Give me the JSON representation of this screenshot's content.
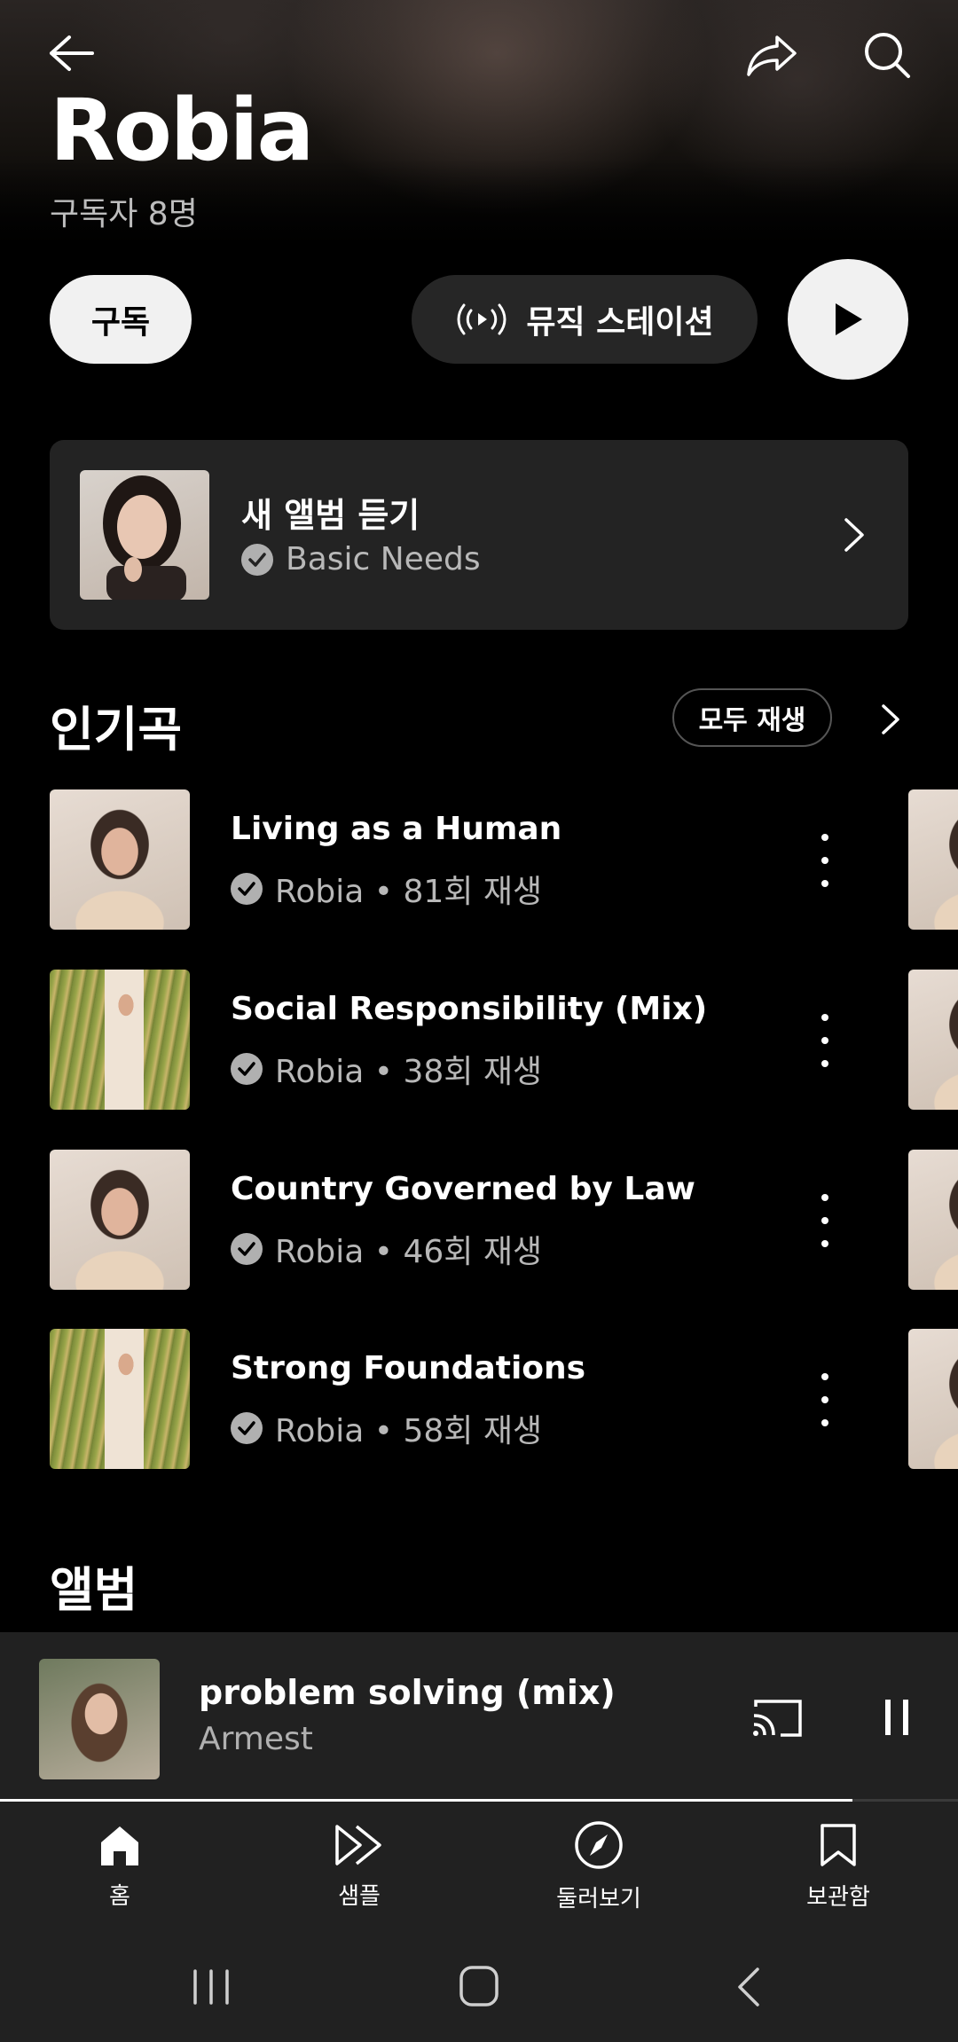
{
  "header": {
    "back_icon": "arrow-left-icon",
    "share_icon": "share-icon",
    "search_icon": "search-icon"
  },
  "artist": {
    "name": "Robia",
    "subscribers": "구독자 8명"
  },
  "actions": {
    "subscribe_label": "구독",
    "station_label": "뮤직 스테이션",
    "station_icon": "radio-icon",
    "play_icon": "play-icon"
  },
  "new_album": {
    "title": "새 앨범 듣기",
    "album": "Basic Needs"
  },
  "popular": {
    "title": "인기곡",
    "play_all": "모두 재생",
    "songs": [
      {
        "title": "Living as a Human",
        "meta": "Robia • 81회 재생"
      },
      {
        "title": "Social Responsibility (Mix)",
        "meta": "Robia • 38회 재생"
      },
      {
        "title": "Country Governed by Law",
        "meta": "Robia • 46회 재생"
      },
      {
        "title": "Strong Foundations",
        "meta": "Robia • 58회 재생"
      }
    ]
  },
  "albums": {
    "title": "앨범"
  },
  "player": {
    "title": "problem solving (mix)",
    "artist": "Armest",
    "progress": 0.89
  },
  "nav": [
    {
      "label": "홈",
      "icon": "home-icon"
    },
    {
      "label": "샘플",
      "icon": "samples-icon"
    },
    {
      "label": "둘러보기",
      "icon": "explore-icon"
    },
    {
      "label": "보관함",
      "icon": "library-icon"
    }
  ],
  "colors": {
    "background": "#000000",
    "surface": "#212121",
    "card": "#232323",
    "pill": "#f1f1f1"
  }
}
